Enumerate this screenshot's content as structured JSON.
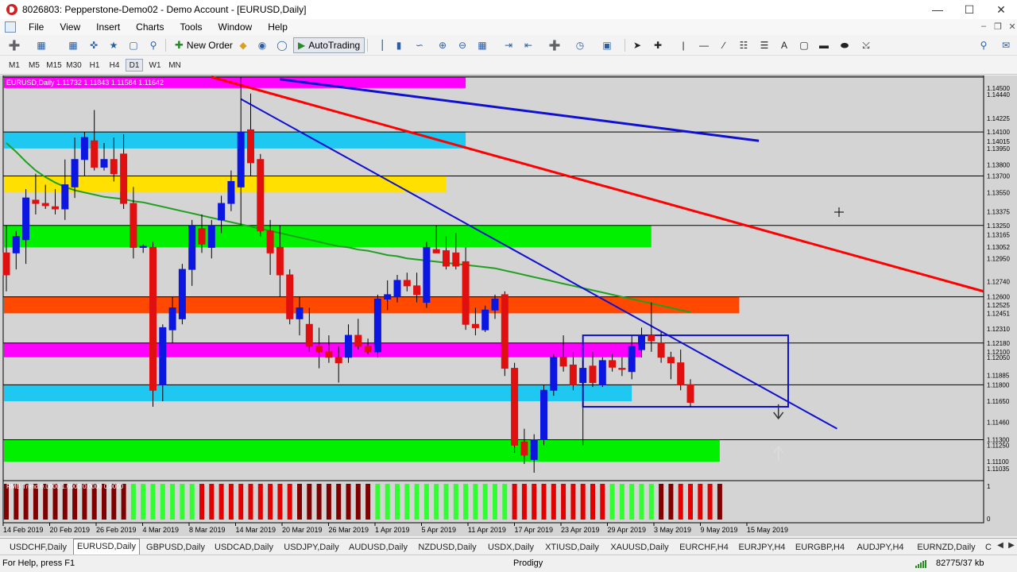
{
  "window": {
    "title": "8026803: Pepperstone-Demo02 - Demo Account - [EURUSD,Daily]",
    "minimize_icon": "minimize-icon",
    "maximize_icon": "maximize-icon",
    "close_icon": "close-icon"
  },
  "menu": {
    "items": [
      "File",
      "View",
      "Insert",
      "Charts",
      "Tools",
      "Window",
      "Help"
    ]
  },
  "toolbar": {
    "new_order_label": "New Order",
    "auto_trading_label": "AutoTrading"
  },
  "periods": [
    "M1",
    "M5",
    "M15",
    "M30",
    "H1",
    "H4",
    "D1",
    "W1",
    "MN"
  ],
  "active_period": "D1",
  "chart": {
    "header": "EURUSD,Daily  1.11732 1.11843 1.11584 1.11642",
    "indicator_label": "RMB Trend 0.0000 1.0000 0.0000 0.0000",
    "indicator_scale_top": "1",
    "indicator_scale_bottom": "0",
    "price_labels": [
      "1.14500",
      "1.14440",
      "1.14225",
      "1.14100",
      "1.14015",
      "1.13950",
      "1.13800",
      "1.13700",
      "1.13550",
      "1.13375",
      "1.13250",
      "1.13165",
      "1.13052",
      "1.12950",
      "1.12740",
      "1.12600",
      "1.12525",
      "1.12451",
      "1.12310",
      "1.12180",
      "1.12100",
      "1.12050",
      "1.11885",
      "1.11800",
      "1.11650",
      "1.11460",
      "1.11300",
      "1.11250",
      "1.11100",
      "1.11035"
    ],
    "date_labels": [
      "14 Feb 2019",
      "20 Feb 2019",
      "26 Feb 2019",
      "4 Mar 2019",
      "8 Mar 2019",
      "14 Mar 2019",
      "20 Mar 2019",
      "26 Mar 2019",
      "1 Apr 2019",
      "5 Apr 2019",
      "11 Apr 2019",
      "17 Apr 2019",
      "23 Apr 2019",
      "29 Apr 2019",
      "3 May 2019",
      "9 May 2019",
      "15 May 2019"
    ],
    "colors": {
      "bull": "#0b16e0",
      "bear": "#e01010",
      "background": "#d4d4d4",
      "magenta_zone": "#ff00ff",
      "cyan_zone": "#1fc8f0",
      "yellow_zone": "#ffe000",
      "green_zone": "#00f000",
      "orange_zone": "#ff4800",
      "trendline_red": "#ff0000",
      "trendline_blue": "#1010d0",
      "ma_green": "#20a020"
    }
  },
  "tabs": [
    "USDCHF,Daily",
    "EURUSD,Daily",
    "GBPUSD,Daily",
    "USDCAD,Daily",
    "USDJPY,Daily",
    "AUDUSD,Daily",
    "NZDUSD,Daily",
    "USDX,Daily",
    "XTIUSD,Daily",
    "XAUUSD,Daily",
    "EURCHF,H4",
    "EURJPY,H4",
    "EURGBP,H4",
    "AUDJPY,H4",
    "EURNZD,Daily",
    "C"
  ],
  "active_tab": "EURUSD,Daily",
  "status": {
    "help_text": "For Help, press F1",
    "profile": "Prodigy",
    "traffic": "82775/37 kb"
  },
  "chart_data": {
    "type": "candlestick",
    "symbol": "EURUSD",
    "timeframe": "Daily",
    "ylim": [
      1.11,
      1.146
    ],
    "candles": [
      {
        "o": 1.13,
        "h": 1.1325,
        "l": 1.1265,
        "c": 1.128
      },
      {
        "o": 1.13,
        "h": 1.132,
        "l": 1.1285,
        "c": 1.1315
      },
      {
        "o": 1.1312,
        "h": 1.1358,
        "l": 1.129,
        "c": 1.135
      },
      {
        "o": 1.1348,
        "h": 1.1372,
        "l": 1.1335,
        "c": 1.1345
      },
      {
        "o": 1.1345,
        "h": 1.1362,
        "l": 1.134,
        "c": 1.1343
      },
      {
        "o": 1.1342,
        "h": 1.1358,
        "l": 1.1335,
        "c": 1.134
      },
      {
        "o": 1.134,
        "h": 1.1385,
        "l": 1.133,
        "c": 1.1362
      },
      {
        "o": 1.136,
        "h": 1.1405,
        "l": 1.135,
        "c": 1.1385
      },
      {
        "o": 1.1385,
        "h": 1.141,
        "l": 1.137,
        "c": 1.1405
      },
      {
        "o": 1.1402,
        "h": 1.143,
        "l": 1.1375,
        "c": 1.1378
      },
      {
        "o": 1.1378,
        "h": 1.14,
        "l": 1.1375,
        "c": 1.1385
      },
      {
        "o": 1.1385,
        "h": 1.1405,
        "l": 1.1365,
        "c": 1.1372
      },
      {
        "o": 1.139,
        "h": 1.1408,
        "l": 1.134,
        "c": 1.1345
      },
      {
        "o": 1.1345,
        "h": 1.136,
        "l": 1.1295,
        "c": 1.1305
      },
      {
        "o": 1.1305,
        "h": 1.1308,
        "l": 1.13,
        "c": 1.1306
      },
      {
        "o": 1.1305,
        "h": 1.131,
        "l": 1.116,
        "c": 1.1175
      },
      {
        "o": 1.118,
        "h": 1.1235,
        "l": 1.1165,
        "c": 1.1232
      },
      {
        "o": 1.123,
        "h": 1.126,
        "l": 1.1218,
        "c": 1.125
      },
      {
        "o": 1.124,
        "h": 1.129,
        "l": 1.1235,
        "c": 1.1285
      },
      {
        "o": 1.1285,
        "h": 1.133,
        "l": 1.127,
        "c": 1.1325
      },
      {
        "o": 1.1322,
        "h": 1.1335,
        "l": 1.13,
        "c": 1.1308
      },
      {
        "o": 1.1305,
        "h": 1.133,
        "l": 1.1295,
        "c": 1.1325
      },
      {
        "o": 1.133,
        "h": 1.1352,
        "l": 1.1318,
        "c": 1.1345
      },
      {
        "o": 1.1345,
        "h": 1.1375,
        "l": 1.1338,
        "c": 1.1365
      },
      {
        "o": 1.136,
        "h": 1.146,
        "l": 1.1325,
        "c": 1.141
      },
      {
        "o": 1.1412,
        "h": 1.1445,
        "l": 1.137,
        "c": 1.1382
      },
      {
        "o": 1.1385,
        "h": 1.139,
        "l": 1.1315,
        "c": 1.132
      },
      {
        "o": 1.132,
        "h": 1.133,
        "l": 1.128,
        "c": 1.13
      },
      {
        "o": 1.1305,
        "h": 1.1325,
        "l": 1.126,
        "c": 1.128
      },
      {
        "o": 1.128,
        "h": 1.1285,
        "l": 1.1235,
        "c": 1.124
      },
      {
        "o": 1.124,
        "h": 1.126,
        "l": 1.1225,
        "c": 1.125
      },
      {
        "o": 1.1235,
        "h": 1.125,
        "l": 1.121,
        "c": 1.1215
      },
      {
        "o": 1.1215,
        "h": 1.1232,
        "l": 1.1195,
        "c": 1.121
      },
      {
        "o": 1.121,
        "h": 1.1225,
        "l": 1.12,
        "c": 1.1205
      },
      {
        "o": 1.1205,
        "h": 1.1215,
        "l": 1.1182,
        "c": 1.12
      },
      {
        "o": 1.1205,
        "h": 1.1235,
        "l": 1.12,
        "c": 1.1225
      },
      {
        "o": 1.1225,
        "h": 1.124,
        "l": 1.1212,
        "c": 1.1215
      },
      {
        "o": 1.1215,
        "h": 1.1222,
        "l": 1.1208,
        "c": 1.121
      },
      {
        "o": 1.121,
        "h": 1.1262,
        "l": 1.1205,
        "c": 1.1258
      },
      {
        "o": 1.1258,
        "h": 1.1275,
        "l": 1.1248,
        "c": 1.1262
      },
      {
        "o": 1.126,
        "h": 1.128,
        "l": 1.1255,
        "c": 1.1275
      },
      {
        "o": 1.1275,
        "h": 1.1282,
        "l": 1.1265,
        "c": 1.127
      },
      {
        "o": 1.127,
        "h": 1.1282,
        "l": 1.1255,
        "c": 1.1262
      },
      {
        "o": 1.1255,
        "h": 1.131,
        "l": 1.125,
        "c": 1.1305
      },
      {
        "o": 1.1303,
        "h": 1.1325,
        "l": 1.13,
        "c": 1.13
      },
      {
        "o": 1.1302,
        "h": 1.1315,
        "l": 1.1285,
        "c": 1.1288
      },
      {
        "o": 1.13,
        "h": 1.1318,
        "l": 1.1285,
        "c": 1.1288
      },
      {
        "o": 1.1292,
        "h": 1.1305,
        "l": 1.123,
        "c": 1.1235
      },
      {
        "o": 1.1235,
        "h": 1.125,
        "l": 1.1225,
        "c": 1.1232
      },
      {
        "o": 1.123,
        "h": 1.1252,
        "l": 1.1228,
        "c": 1.1248
      },
      {
        "o": 1.1248,
        "h": 1.1262,
        "l": 1.124,
        "c": 1.1258
      },
      {
        "o": 1.1262,
        "h": 1.1265,
        "l": 1.1188,
        "c": 1.1195
      },
      {
        "o": 1.1195,
        "h": 1.12,
        "l": 1.1118,
        "c": 1.1125
      },
      {
        "o": 1.1128,
        "h": 1.114,
        "l": 1.1108,
        "c": 1.1116
      },
      {
        "o": 1.1112,
        "h": 1.1135,
        "l": 1.11,
        "c": 1.113
      },
      {
        "o": 1.113,
        "h": 1.118,
        "l": 1.1125,
        "c": 1.1175
      },
      {
        "o": 1.1175,
        "h": 1.1208,
        "l": 1.117,
        "c": 1.1205
      },
      {
        "o": 1.1205,
        "h": 1.1225,
        "l": 1.1192,
        "c": 1.1197
      },
      {
        "o": 1.1198,
        "h": 1.121,
        "l": 1.1175,
        "c": 1.118
      },
      {
        "o": 1.1182,
        "h": 1.1202,
        "l": 1.1125,
        "c": 1.1195
      },
      {
        "o": 1.1197,
        "h": 1.121,
        "l": 1.1178,
        "c": 1.1182
      },
      {
        "o": 1.118,
        "h": 1.1205,
        "l": 1.1178,
        "c": 1.1202
      },
      {
        "o": 1.1202,
        "h": 1.1208,
        "l": 1.1192,
        "c": 1.1196
      },
      {
        "o": 1.1195,
        "h": 1.1205,
        "l": 1.1188,
        "c": 1.1194
      },
      {
        "o": 1.1192,
        "h": 1.1225,
        "l": 1.1185,
        "c": 1.1215
      },
      {
        "o": 1.1212,
        "h": 1.1232,
        "l": 1.1205,
        "c": 1.1225
      },
      {
        "o": 1.1225,
        "h": 1.1255,
        "l": 1.121,
        "c": 1.122
      },
      {
        "o": 1.1218,
        "h": 1.1228,
        "l": 1.12,
        "c": 1.1205
      },
      {
        "o": 1.1205,
        "h": 1.121,
        "l": 1.1185,
        "c": 1.12
      },
      {
        "o": 1.12,
        "h": 1.1212,
        "l": 1.1175,
        "c": 1.118
      },
      {
        "o": 1.118,
        "h": 1.1185,
        "l": 1.116,
        "c": 1.1164
      }
    ],
    "moving_average": [
      1.14,
      1.1392,
      1.1383,
      1.1375,
      1.1369,
      1.1364,
      1.136,
      1.1357,
      1.1355,
      1.1353,
      1.1351,
      1.135,
      1.1349,
      1.1347,
      1.1346,
      1.1344,
      1.1342,
      1.134,
      1.1338,
      1.1336,
      1.1334,
      1.1332,
      1.133,
      1.1328,
      1.1326,
      1.1324,
      1.1322,
      1.132,
      1.1318,
      1.1316,
      1.1314,
      1.1312,
      1.131,
      1.1308,
      1.1306,
      1.1305,
      1.1303,
      1.1302,
      1.13,
      1.1298,
      1.1297,
      1.1295,
      1.1294,
      1.1293,
      1.1292,
      1.1291,
      1.129,
      1.1289,
      1.1288,
      1.1287,
      1.1286,
      1.1284,
      1.1282,
      1.128,
      1.1278,
      1.1276,
      1.1274,
      1.1272,
      1.127,
      1.1268,
      1.1266,
      1.1264,
      1.1262,
      1.126,
      1.1258,
      1.1256,
      1.1254,
      1.1252,
      1.125,
      1.1248,
      1.1246
    ],
    "zones": [
      {
        "color": "magenta",
        "from": 1.145,
        "to": 1.146,
        "end_index": "47"
      },
      {
        "color": "cyan",
        "from": 1.1395,
        "to": 1.141,
        "end_index": "47"
      },
      {
        "color": "yellow",
        "from": 1.1355,
        "to": 1.137,
        "end_index": "45"
      },
      {
        "color": "green",
        "from": 1.1305,
        "to": 1.1325,
        "end_index": "66"
      },
      {
        "color": "orange",
        "from": 1.1245,
        "to": 1.126,
        "end_index": "75"
      },
      {
        "color": "magenta",
        "from": 1.1205,
        "to": 1.1218,
        "end_index": "65"
      },
      {
        "color": "cyan",
        "from": 1.1165,
        "to": 1.118,
        "end_index": "64"
      },
      {
        "color": "green",
        "from": 1.111,
        "to": 1.113,
        "end_index": "73"
      }
    ],
    "indicator_bars": [
      "d",
      "d",
      "d",
      "d",
      "d",
      "d",
      "d",
      "d",
      "d",
      "d",
      "d",
      "d",
      "d",
      "g",
      "g",
      "g",
      "g",
      "g",
      "g",
      "g",
      "r",
      "r",
      "r",
      "r",
      "r",
      "r",
      "r",
      "r",
      "r",
      "r",
      "d",
      "d",
      "d",
      "d",
      "d",
      "d",
      "d",
      "d",
      "g",
      "g",
      "g",
      "g",
      "g",
      "g",
      "g",
      "g",
      "g",
      "g",
      "g",
      "g",
      "g",
      "g",
      "r",
      "r",
      "r",
      "r",
      "r",
      "r",
      "r",
      "r",
      "r",
      "r",
      "g",
      "g",
      "g",
      "g",
      "g",
      "d",
      "d",
      "r",
      "r",
      "r",
      "r",
      "d"
    ]
  }
}
